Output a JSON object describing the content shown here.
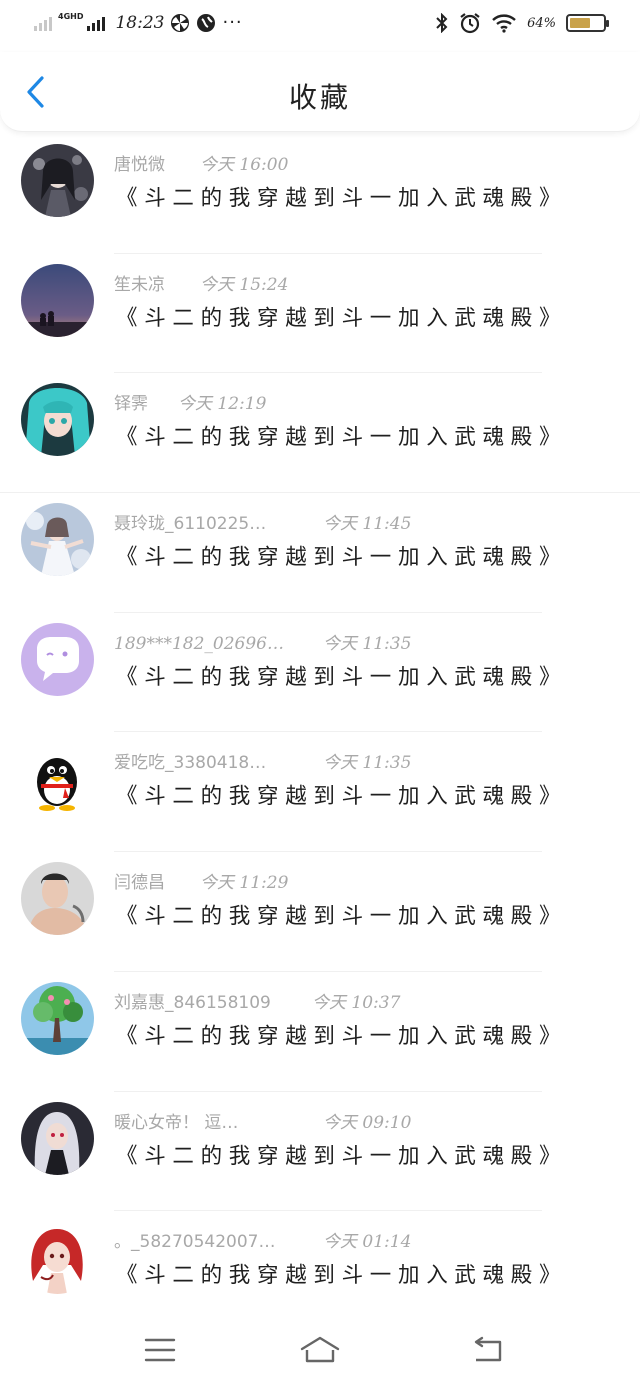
{
  "status_bar": {
    "network": "4GHD",
    "time": "18:23",
    "more": "···",
    "battery_percent": "64%",
    "battery_level": 0.64,
    "icons": [
      "pinwheel-icon",
      "globe-icon",
      "bluetooth-icon",
      "alarm-icon",
      "wifi-icon",
      "battery-icon"
    ]
  },
  "header": {
    "title": "收藏",
    "back_icon": "chevron-left-icon",
    "accent_color": "#1e88e5"
  },
  "favorites": [
    {
      "author": "唐悦微",
      "date": "今天 16:00",
      "title": "《斗二的我穿越到斗一加入武魂殿》",
      "avatar": "anime-girl-dark"
    },
    {
      "author": "笙未凉",
      "date": "今天 15:24",
      "title": "《斗二的我穿越到斗一加入武魂殿》",
      "avatar": "night-sky-couple"
    },
    {
      "author": "铎霁",
      "date": "今天 12:19",
      "title": "《斗二的我穿越到斗一加入武魂殿》",
      "avatar": "teal-hair-anime"
    },
    {
      "author": "聂玲珑_6110225…",
      "date": "今天 11:45",
      "title": "《斗二的我穿越到斗一加入武魂殿》",
      "avatar": "white-dress-girl"
    },
    {
      "author": "189***182_02696…",
      "date": "今天 11:35",
      "title": "《斗二的我穿越到斗一加入武魂殿》",
      "avatar": "purple-chat-bubble"
    },
    {
      "author": "爱吃吃_3380418…",
      "date": "今天 11:35",
      "title": "《斗二的我穿越到斗一加入武魂殿》",
      "avatar": "qq-penguin"
    },
    {
      "author": "闫德昌",
      "date": "今天 11:29",
      "title": "《斗二的我穿越到斗一加入武魂殿》",
      "avatar": "man-portrait"
    },
    {
      "author": "刘嘉惠_846158109",
      "date": "今天 10:37",
      "title": "《斗二的我穿越到斗一加入武魂殿》",
      "avatar": "tree-scene"
    },
    {
      "author": "暖心女帝！ 逗…",
      "date": "今天 09:10",
      "title": "《斗二的我穿越到斗一加入武魂殿》",
      "avatar": "silver-hair-girl"
    },
    {
      "author": "。_58270542007…",
      "date": "今天 01:14",
      "title": "《斗二的我穿越到斗一加入武魂殿》",
      "avatar": "red-hair-girl"
    }
  ],
  "bottom_nav": {
    "icons": [
      "menu-icon",
      "home-icon",
      "back-icon"
    ]
  }
}
